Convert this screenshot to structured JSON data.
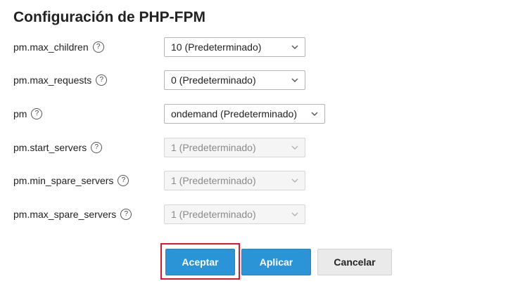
{
  "page": {
    "title": "Configuración de PHP-FPM"
  },
  "help_glyph": "?",
  "fields": [
    {
      "label": "pm.max_children",
      "value": "10 (Predeterminado)",
      "enabled": true
    },
    {
      "label": "pm.max_requests",
      "value": "0 (Predeterminado)",
      "enabled": true
    },
    {
      "label": "pm",
      "value": "ondemand (Predeterminado)",
      "enabled": true
    },
    {
      "label": "pm.start_servers",
      "value": "1 (Predeterminado)",
      "enabled": false
    },
    {
      "label": "pm.min_spare_servers",
      "value": "1 (Predeterminado)",
      "enabled": false
    },
    {
      "label": "pm.max_spare_servers",
      "value": "1 (Predeterminado)",
      "enabled": false
    }
  ],
  "buttons": {
    "accept": "Aceptar",
    "apply": "Aplicar",
    "cancel": "Cancelar"
  },
  "colors": {
    "primary": "#2b94d7",
    "secondary": "#eaeaea",
    "highlight": "#e2172b"
  },
  "icons": {
    "help": "question-circle-icon",
    "dropdown": "chevron-down-icon"
  }
}
